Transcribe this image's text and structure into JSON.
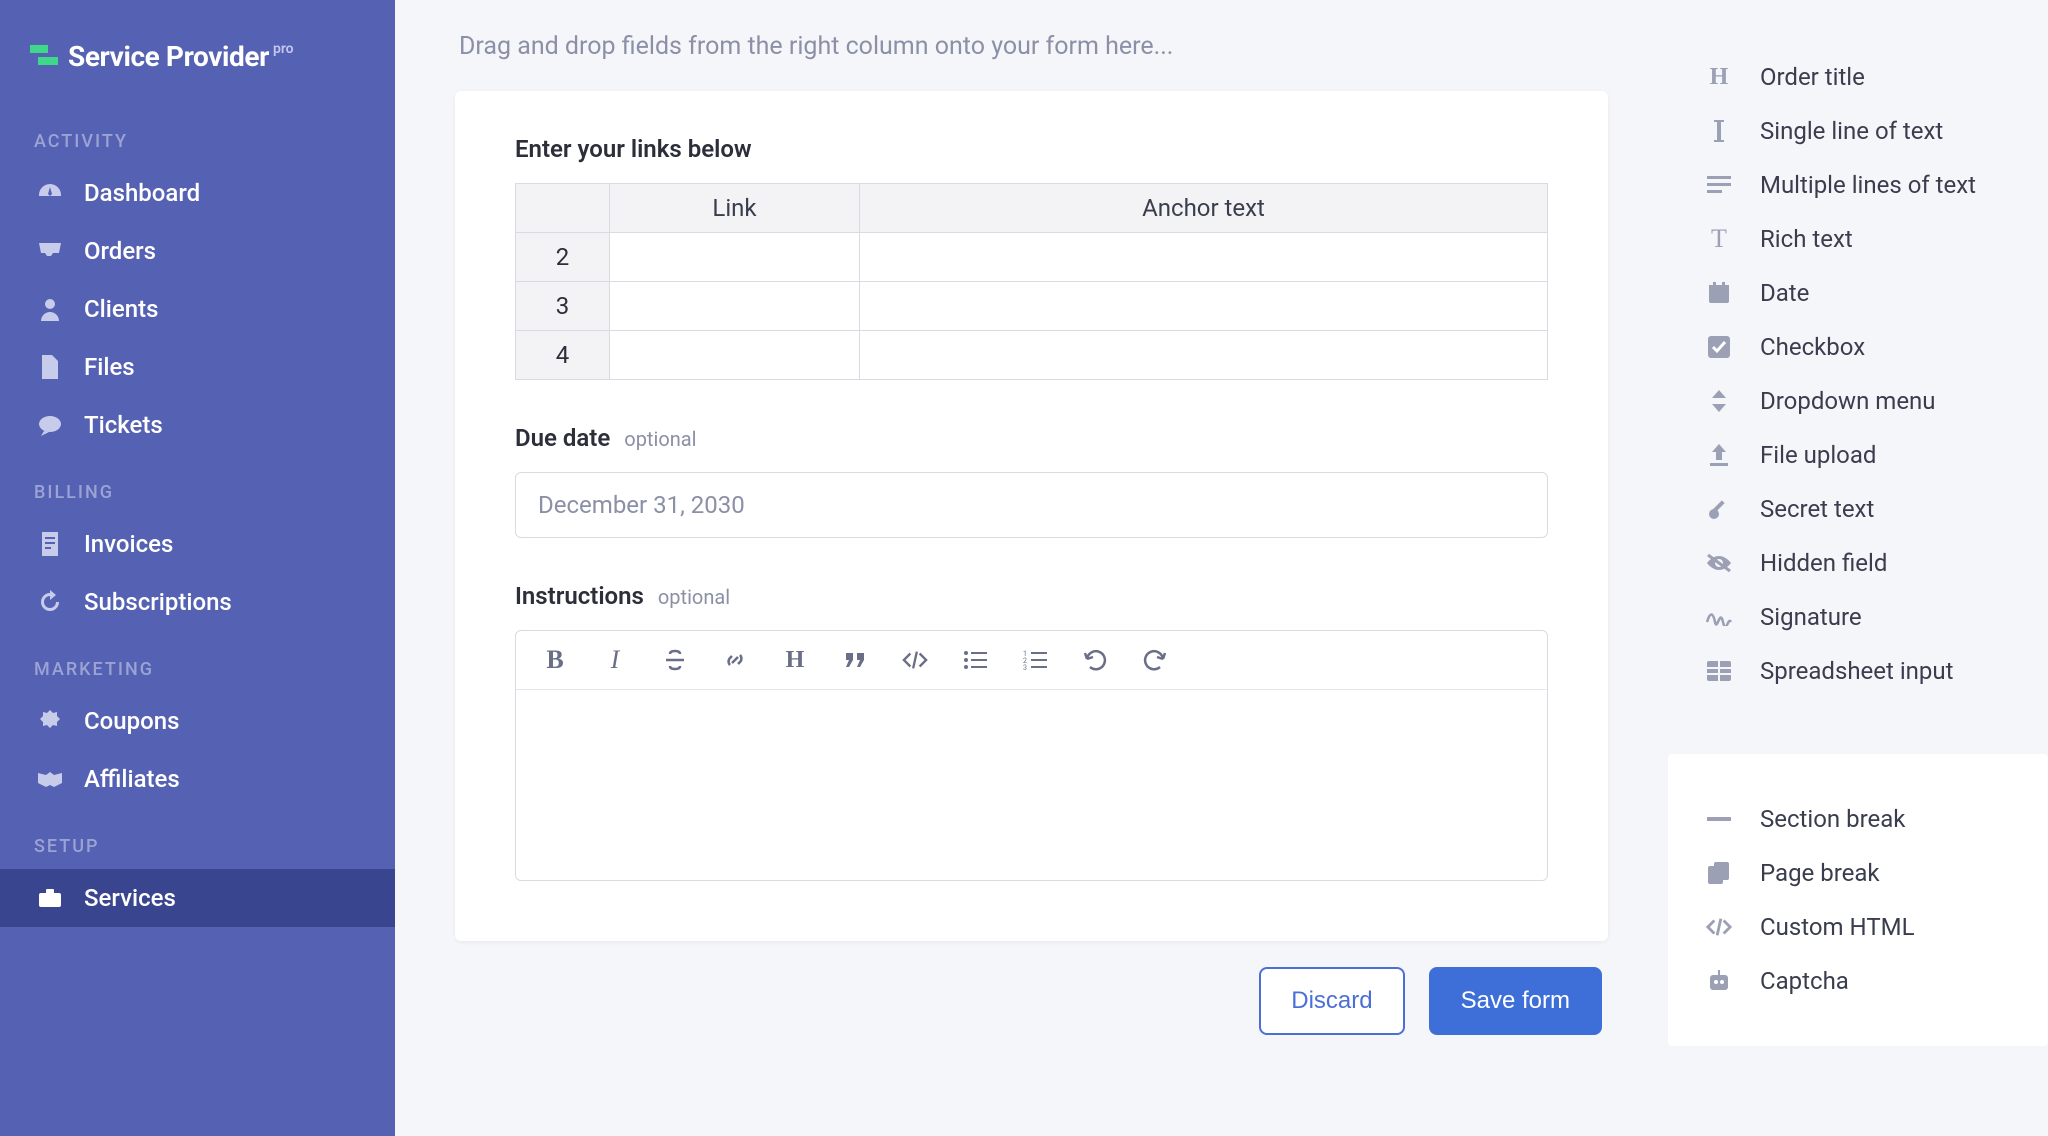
{
  "brand": {
    "name": "Service Provider",
    "suffix": "pro"
  },
  "sidebar": {
    "sections": [
      {
        "label": "ACTIVITY",
        "items": [
          {
            "id": "dashboard",
            "label": "Dashboard"
          },
          {
            "id": "orders",
            "label": "Orders"
          },
          {
            "id": "clients",
            "label": "Clients"
          },
          {
            "id": "files",
            "label": "Files"
          },
          {
            "id": "tickets",
            "label": "Tickets"
          }
        ]
      },
      {
        "label": "BILLING",
        "items": [
          {
            "id": "invoices",
            "label": "Invoices"
          },
          {
            "id": "subscriptions",
            "label": "Subscriptions"
          }
        ]
      },
      {
        "label": "MARKETING",
        "items": [
          {
            "id": "coupons",
            "label": "Coupons"
          },
          {
            "id": "affiliates",
            "label": "Affiliates"
          }
        ]
      },
      {
        "label": "SETUP",
        "items": [
          {
            "id": "services",
            "label": "Services",
            "active": true
          }
        ]
      }
    ]
  },
  "hint": "Drag and drop fields from the right column onto your form here...",
  "form": {
    "links_title": "Enter your links below",
    "table_headers": {
      "col1": "Link",
      "col2": "Anchor text"
    },
    "table_rows": [
      "2",
      "3",
      "4"
    ],
    "due_label": "Due date",
    "due_value": "December 31, 2030",
    "instructions_label": "Instructions",
    "optional": "optional"
  },
  "buttons": {
    "discard": "Discard",
    "save": "Save form"
  },
  "palette": {
    "group1": [
      {
        "id": "order-title",
        "label": "Order title"
      },
      {
        "id": "single-line",
        "label": "Single line of text"
      },
      {
        "id": "multi-line",
        "label": "Multiple lines of text"
      },
      {
        "id": "rich-text",
        "label": "Rich text"
      },
      {
        "id": "date",
        "label": "Date"
      },
      {
        "id": "checkbox",
        "label": "Checkbox"
      },
      {
        "id": "dropdown",
        "label": "Dropdown menu"
      },
      {
        "id": "file-upload",
        "label": "File upload"
      },
      {
        "id": "secret",
        "label": "Secret text"
      },
      {
        "id": "hidden",
        "label": "Hidden field"
      },
      {
        "id": "signature",
        "label": "Signature"
      },
      {
        "id": "spreadsheet",
        "label": "Spreadsheet input"
      }
    ],
    "group2": [
      {
        "id": "section-break",
        "label": "Section break"
      },
      {
        "id": "page-break",
        "label": "Page break"
      },
      {
        "id": "custom-html",
        "label": "Custom HTML"
      },
      {
        "id": "captcha",
        "label": "Captcha"
      }
    ]
  }
}
